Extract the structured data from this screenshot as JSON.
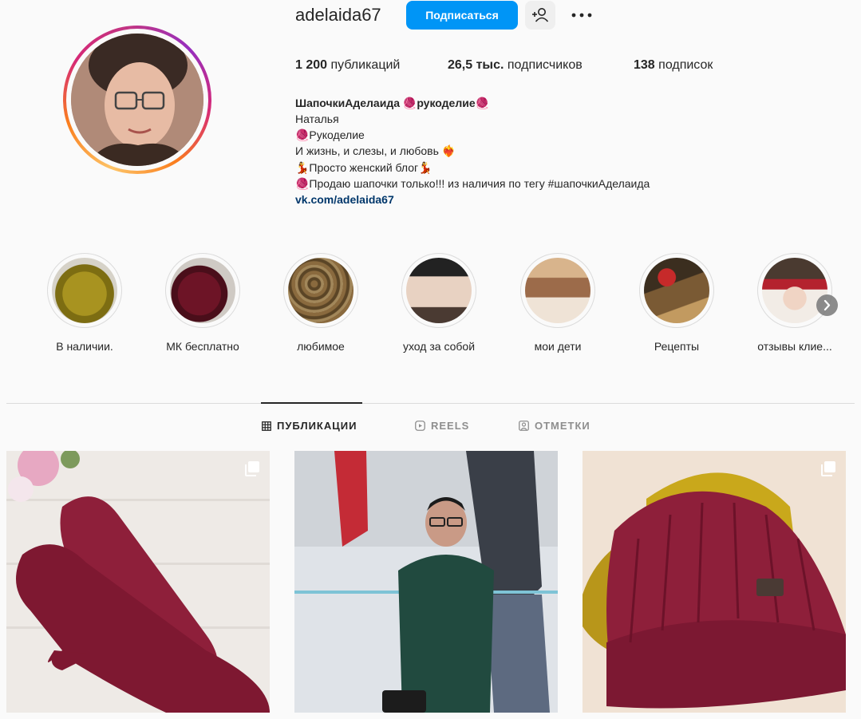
{
  "profile": {
    "username": "adelaida67",
    "follow_label": "Подписаться",
    "suggest_icon": "person-plus-icon",
    "more_icon": "more-dots-icon"
  },
  "stats": {
    "posts_count": "1 200",
    "posts_label": "публикаций",
    "followers_count": "26,5 тыс.",
    "followers_label": "подписчиков",
    "following_count": "138",
    "following_label": "подписок"
  },
  "bio": {
    "title": "ШапочкиАделаида 🧶рукоделие🧶",
    "line1": "Наталья",
    "line2": "🧶Рукоделие",
    "line3": "И жизнь, и слезы, и любовь ❤️‍🔥",
    "line4": "💃Просто женский блог💃",
    "line5": "🧶Продаю шапочки только!!! из наличия по тегу #шапочкиАделаида",
    "link": "vk.com/adelaida67"
  },
  "highlights": [
    {
      "label": "В наличии."
    },
    {
      "label": "МК бесплатно"
    },
    {
      "label": "любимое"
    },
    {
      "label": "уход за собой"
    },
    {
      "label": "мои дети"
    },
    {
      "label": "Рецепты"
    },
    {
      "label": "отзывы клие..."
    }
  ],
  "tabs": [
    {
      "label": "ПУБЛИКАЦИИ",
      "icon": "grid-icon",
      "active": true
    },
    {
      "label": "REELS",
      "icon": "reels-icon",
      "active": false
    },
    {
      "label": "ОТМЕТКИ",
      "icon": "tagged-icon",
      "active": false
    }
  ],
  "posts": [
    {
      "subject": "knitted burgundy mittens",
      "multi": true
    },
    {
      "subject": "woman in green dress",
      "multi": false
    },
    {
      "subject": "burgundy and mustard knitted hats",
      "multi": true
    }
  ],
  "colors": {
    "accent": "#0095f6",
    "link": "#00376b",
    "burgundy": "#8e1f3a",
    "mustard": "#c9a81b"
  }
}
